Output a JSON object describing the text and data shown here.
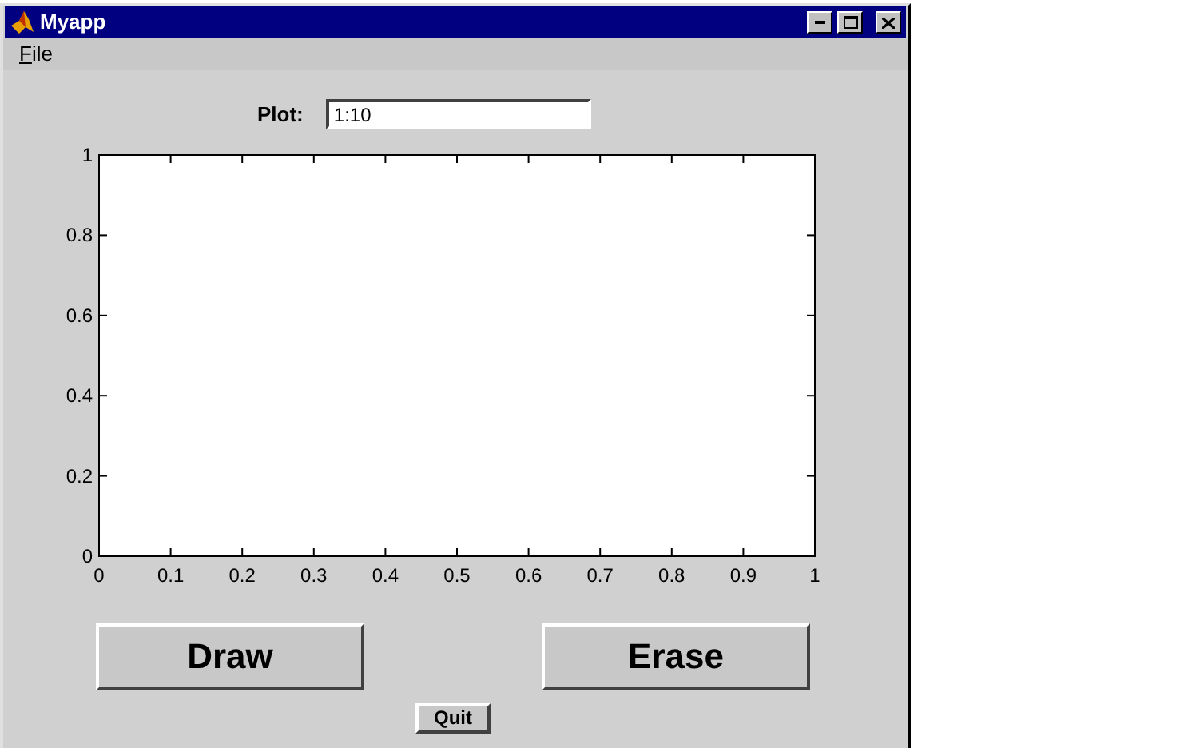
{
  "window": {
    "title": "Myapp"
  },
  "menu": [
    {
      "label": "File"
    }
  ],
  "plot_field": {
    "label": "Plot:",
    "value": "1:10"
  },
  "axes": {
    "chart_data": {
      "type": "line",
      "xlim": [
        0,
        1
      ],
      "ylim": [
        0,
        1
      ],
      "xticks": [
        0,
        0.1,
        0.2,
        0.3,
        0.4,
        0.5,
        0.6,
        0.7,
        0.8,
        0.9,
        1
      ],
      "yticks": [
        0,
        0.2,
        0.4,
        0.6,
        0.8,
        1
      ]
    }
  },
  "buttons": [
    {
      "label": "Draw",
      "kind": "large"
    },
    {
      "label": "Erase",
      "kind": "large"
    },
    {
      "label": "Quit",
      "kind": "small"
    }
  ]
}
